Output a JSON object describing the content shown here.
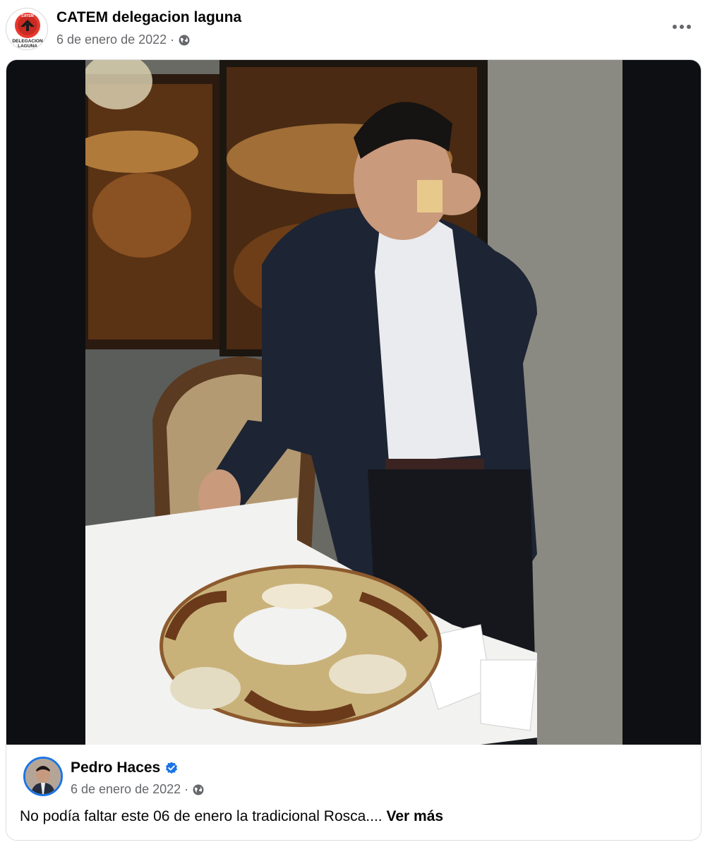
{
  "post": {
    "page_name": "CATEM delegacion laguna",
    "date": "6 de enero de 2022",
    "separator": "·",
    "privacy_icon": "globe-icon",
    "more_icon": "more-options-icon",
    "avatar_label_top": "CATEM",
    "avatar_label_line1": "DELEGACION",
    "avatar_label_line2": "LAGUNA"
  },
  "shared": {
    "author_name": "Pedro Haces",
    "verified_icon": "verified-badge-icon",
    "date": "6 de enero de 2022",
    "separator": "·",
    "privacy_icon": "globe-icon",
    "text": "No podía faltar este 06 de enero la tradicional Rosca....",
    "see_more": "Ver más"
  },
  "colors": {
    "brand_blue": "#1b74e4",
    "meta_gray": "#65676b",
    "photo_letterbox": "#0e0f12"
  }
}
